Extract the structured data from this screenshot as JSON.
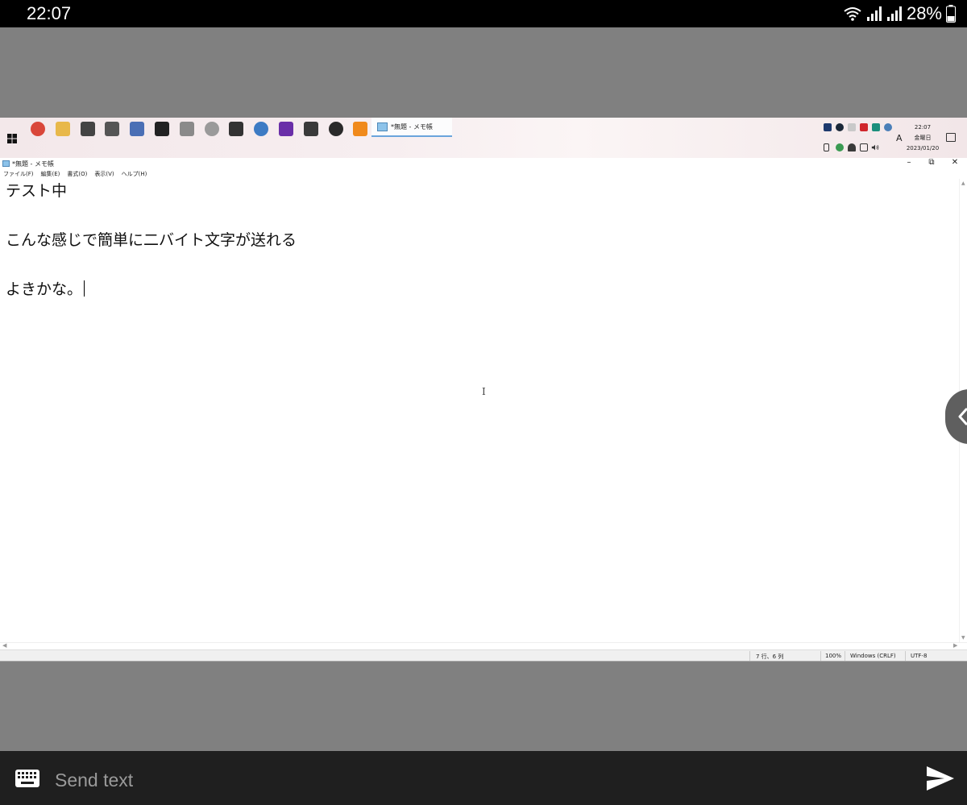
{
  "status_bar": {
    "time": "22:07",
    "battery": "28%"
  },
  "taskbar": {
    "active_window_label": "*無題 - メモ帳",
    "ime_indicator": "A",
    "clock": {
      "time": "22:07",
      "weekday": "金曜日",
      "date": "2023/01/20"
    },
    "app_icons": [
      {
        "name": "chrome-icon",
        "color": "#d9473a"
      },
      {
        "name": "folder-icon",
        "color": "#e8b84a"
      },
      {
        "name": "window-icon",
        "color": "#444444"
      },
      {
        "name": "window-icon",
        "color": "#555555"
      },
      {
        "name": "photo-icon",
        "color": "#4a6fb5"
      },
      {
        "name": "film-icon",
        "color": "#222222"
      },
      {
        "name": "tool-icon",
        "color": "#8a8a8a"
      },
      {
        "name": "alien-icon",
        "color": "#9a9a9a"
      },
      {
        "name": "ncv-icon",
        "color": "#333333"
      },
      {
        "name": "globe-icon",
        "color": "#3d7bc4"
      },
      {
        "name": "headphones-icon",
        "color": "#6a2fa8"
      },
      {
        "name": "terminal-icon",
        "color": "#3a3a3a"
      },
      {
        "name": "obs-icon",
        "color": "#2a2a2a"
      },
      {
        "name": "vlc-icon",
        "color": "#f08a1c"
      }
    ]
  },
  "notepad": {
    "title": "*無題 - メモ帳",
    "menu": [
      "ファイル(F)",
      "編集(E)",
      "書式(O)",
      "表示(V)",
      "ヘルプ(H)"
    ],
    "lines": [
      "テスト中",
      "こんな感じで簡単に二バイト文字が送れる",
      "よきかな。"
    ],
    "status": {
      "position": "7 行、6 列",
      "zoom": "100%",
      "line_ending": "Windows (CRLF)",
      "encoding": "UTF-8"
    }
  },
  "send_bar": {
    "placeholder": "Send text",
    "value": ""
  },
  "colors": {
    "status_bar_bg": "#000000",
    "page_bg": "#808080",
    "input_bar_bg": "#1f1f1f",
    "active_tab_accent": "#6aa4dc"
  }
}
